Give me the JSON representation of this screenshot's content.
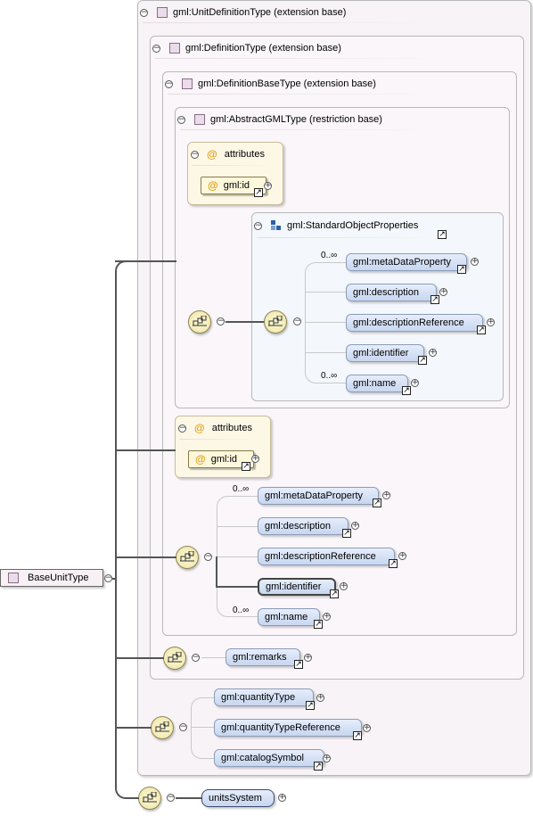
{
  "root": {
    "label": "BaseUnitType"
  },
  "boxes": {
    "unit_definition": "gml:UnitDefinitionType (extension base)",
    "definition": "gml:DefinitionType (extension base)",
    "definition_base": "gml:DefinitionBaseType (extension base)",
    "abstract_gml": "gml:AbstractGMLType (restriction base)",
    "standard_object_properties": "gml:StandardObjectProperties"
  },
  "attributes": {
    "title": "attributes",
    "at_symbol": "@",
    "id_attr": "gml:id"
  },
  "sop_elements": [
    {
      "label": "gml:metaDataProperty",
      "card": "0..∞"
    },
    {
      "label": "gml:description",
      "card": ""
    },
    {
      "label": "gml:descriptionReference",
      "card": ""
    },
    {
      "label": "gml:identifier",
      "card": ""
    },
    {
      "label": "gml:name",
      "card": "0..∞"
    }
  ],
  "def_elements": [
    {
      "label": "gml:metaDataProperty",
      "card": "0..∞"
    },
    {
      "label": "gml:description",
      "card": ""
    },
    {
      "label": "gml:descriptionReference",
      "card": ""
    },
    {
      "label": "gml:identifier",
      "card": ""
    },
    {
      "label": "gml:name",
      "card": "0..∞"
    }
  ],
  "unitdef_elements": [
    {
      "label": "gml:remarks"
    }
  ],
  "choice_elements": [
    {
      "label": "gml:quantityType"
    },
    {
      "label": "gml:quantityTypeReference"
    },
    {
      "label": "gml:catalogSymbol"
    }
  ],
  "base_elements": [
    {
      "label": "unitsSystem"
    }
  ],
  "colors": {
    "element_fill": "#c7d6ef",
    "attribute_fill": "#fdf7dc",
    "compositor_fill": "#fefbd8",
    "type_box_fill": "#faf6f9"
  }
}
